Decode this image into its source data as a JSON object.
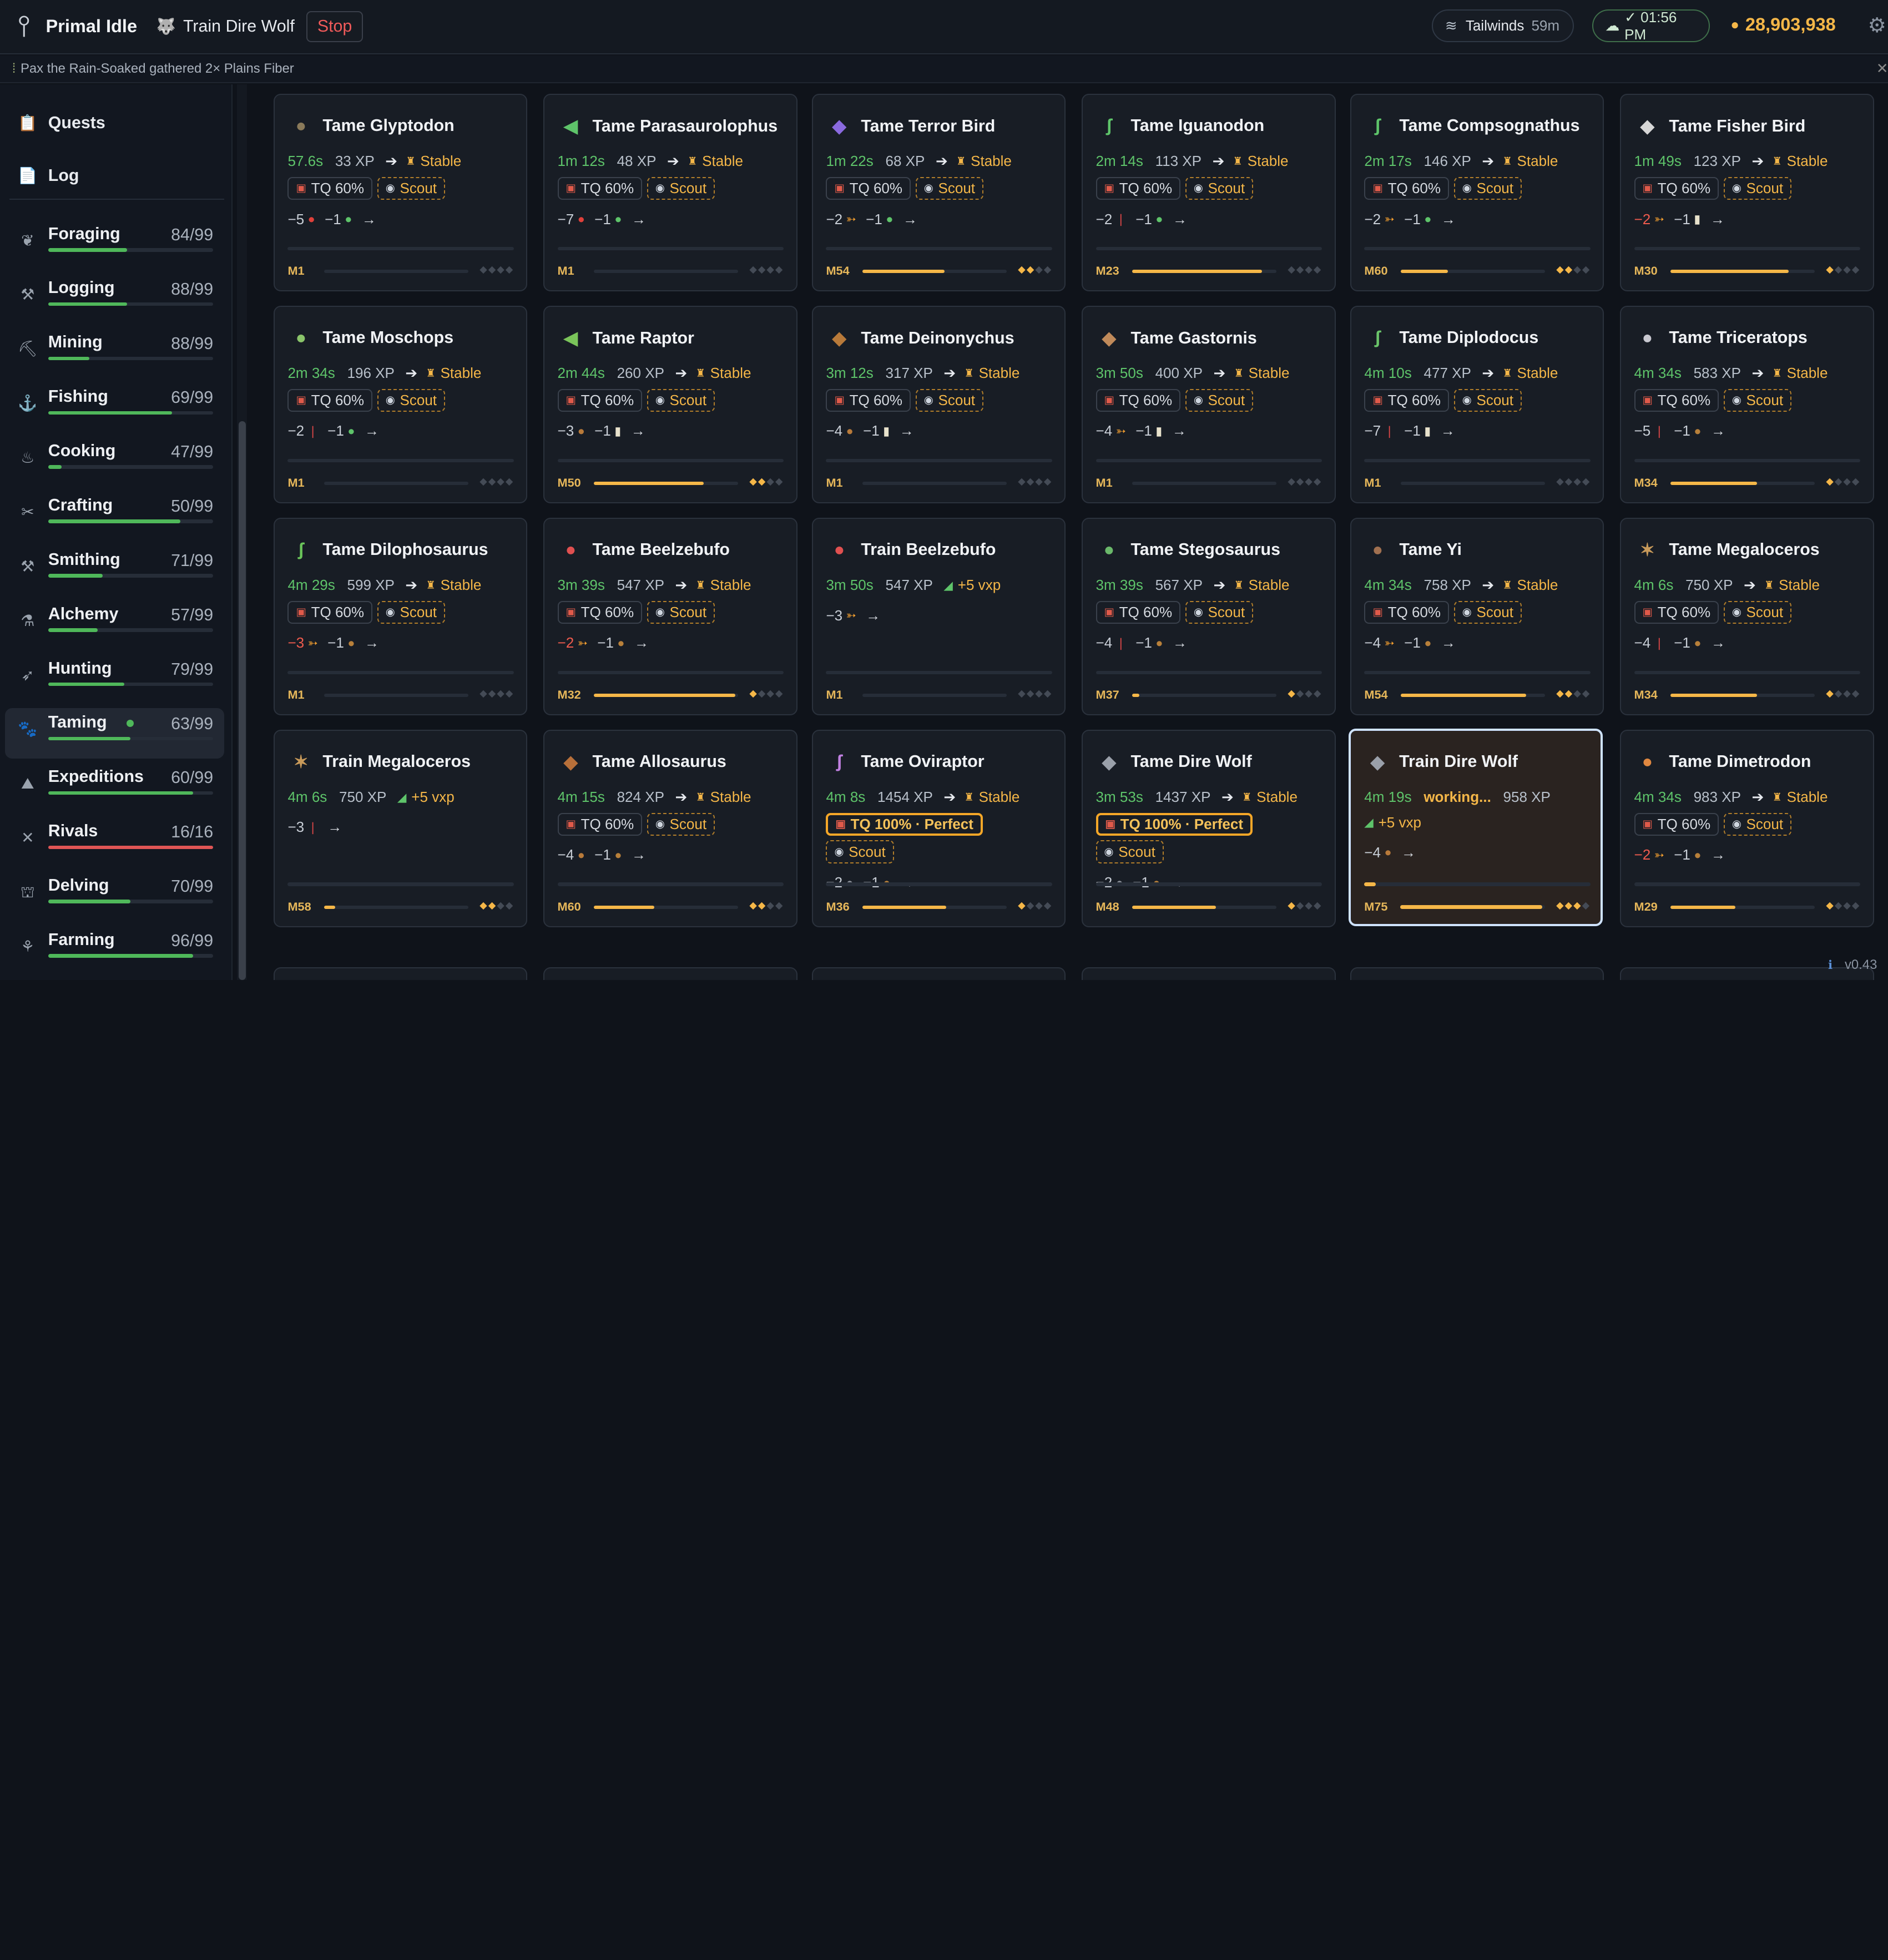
{
  "header": {
    "app_title": "Primal Idle",
    "current_activity": "Train Dire Wolf",
    "current_activity_icon": "wolf-icon",
    "stop_label": "Stop",
    "tailwinds_label": "Tailwinds",
    "tailwinds_time": "59m",
    "clock": "✓ 01:56 PM",
    "gold": "28,903,938"
  },
  "notice": {
    "text": "Pax the Rain-Soaked gathered 2× Plains Fiber"
  },
  "sidebar": {
    "top": [
      {
        "label": "Quests",
        "icon": "quests-icon"
      },
      {
        "label": "Log",
        "icon": "log-icon"
      }
    ],
    "skills": [
      {
        "name": "Foraging",
        "level": "84/99",
        "progress": 0.48,
        "icon": "foraging-icon",
        "color": "#4fb85a"
      },
      {
        "name": "Logging",
        "level": "88/99",
        "progress": 0.48,
        "icon": "logging-icon",
        "color": "#4fb85a"
      },
      {
        "name": "Mining",
        "level": "88/99",
        "progress": 0.25,
        "icon": "mining-icon",
        "color": "#4fb85a"
      },
      {
        "name": "Fishing",
        "level": "69/99",
        "progress": 0.75,
        "icon": "fishing-icon",
        "color": "#4fb85a"
      },
      {
        "name": "Cooking",
        "level": "47/99",
        "progress": 0.08,
        "icon": "cooking-icon",
        "color": "#4fb85a"
      },
      {
        "name": "Crafting",
        "level": "50/99",
        "progress": 0.8,
        "icon": "crafting-icon",
        "color": "#4fb85a"
      },
      {
        "name": "Smithing",
        "level": "71/99",
        "progress": 0.33,
        "icon": "smithing-icon",
        "color": "#4fb85a"
      },
      {
        "name": "Alchemy",
        "level": "57/99",
        "progress": 0.3,
        "icon": "alchemy-icon",
        "color": "#4fb85a"
      },
      {
        "name": "Hunting",
        "level": "79/99",
        "progress": 0.46,
        "icon": "hunting-icon",
        "color": "#4fb85a"
      },
      {
        "name": "Taming",
        "level": "63/99",
        "progress": 0.5,
        "icon": "taming-icon",
        "color": "#4fb85a",
        "active": true
      },
      {
        "name": "Expeditions",
        "level": "60/99",
        "progress": 0.88,
        "icon": "expeditions-icon",
        "color": "#4fb85a"
      },
      {
        "name": "Rivals",
        "level": "16/16",
        "progress": 1.0,
        "icon": "rivals-icon",
        "color": "#e05555"
      },
      {
        "name": "Delving",
        "level": "70/99",
        "progress": 0.5,
        "icon": "delving-icon",
        "color": "#4fb85a"
      },
      {
        "name": "Farming",
        "level": "96/99",
        "progress": 0.88,
        "icon": "farming-icon",
        "color": "#4fb85a"
      }
    ]
  },
  "cards": [
    {
      "title": "Tame Glyptodon",
      "icon": "glyptodon-icon",
      "time": "57.6s",
      "xp": "33 XP",
      "result": "Stable",
      "tags": [
        "TQ 60%",
        "Scout"
      ],
      "reqs": [
        {
          "n": "−5",
          "i": "red-berry-icon"
        },
        {
          "n": "−1",
          "i": "green-drop-icon"
        }
      ],
      "mastery": "M1",
      "mprog": 0.0,
      "diamonds": 0
    },
    {
      "title": "Tame Parasaurolophus",
      "icon": "parasaurolophus-icon",
      "time": "1m 12s",
      "xp": "48 XP",
      "result": "Stable",
      "tags": [
        "TQ 60%",
        "Scout"
      ],
      "reqs": [
        {
          "n": "−7",
          "i": "red-berry-icon"
        },
        {
          "n": "−1",
          "i": "green-drop-icon"
        }
      ],
      "mastery": "M1",
      "mprog": 0.0,
      "diamonds": 0
    },
    {
      "title": "Tame Terror Bird",
      "icon": "terror-bird-icon",
      "time": "1m 22s",
      "xp": "68 XP",
      "result": "Stable",
      "tags": [
        "TQ 60%",
        "Scout"
      ],
      "reqs": [
        {
          "n": "−2",
          "i": "fish-icon"
        },
        {
          "n": "−1",
          "i": "green-drop-icon"
        }
      ],
      "mastery": "M54",
      "mprog": 0.57,
      "diamonds": 2
    },
    {
      "title": "Tame Iguanodon",
      "icon": "iguanodon-icon",
      "time": "2m 14s",
      "xp": "113 XP",
      "result": "Stable",
      "tags": [
        "TQ 60%",
        "Scout"
      ],
      "reqs": [
        {
          "n": "−2",
          "i": "red-stick-icon"
        },
        {
          "n": "−1",
          "i": "green-drop-icon"
        }
      ],
      "mastery": "M23",
      "mprog": 0.9,
      "diamonds": 0
    },
    {
      "title": "Tame Compsognathus",
      "icon": "compsognathus-icon",
      "time": "2m 17s",
      "xp": "146 XP",
      "result": "Stable",
      "tags": [
        "TQ 60%",
        "Scout"
      ],
      "reqs": [
        {
          "n": "−2",
          "i": "fish-icon"
        },
        {
          "n": "−1",
          "i": "green-drop-icon"
        }
      ],
      "mastery": "M60",
      "mprog": 0.33,
      "diamonds": 2
    },
    {
      "title": "Tame Fisher Bird",
      "icon": "fisher-bird-icon",
      "time": "1m 49s",
      "xp": "123 XP",
      "result": "Stable",
      "tags": [
        "TQ 60%",
        "Scout"
      ],
      "reqs": [
        {
          "n": "−2",
          "i": "fish-icon",
          "red": true
        },
        {
          "n": "−1",
          "i": "jar-icon"
        }
      ],
      "mastery": "M30",
      "mprog": 0.82,
      "diamonds": 1
    },
    {
      "title": "Tame Moschops",
      "icon": "moschops-icon",
      "time": "2m 34s",
      "xp": "196 XP",
      "result": "Stable",
      "tags": [
        "TQ 60%",
        "Scout"
      ],
      "reqs": [
        {
          "n": "−2",
          "i": "red-stick-icon"
        },
        {
          "n": "−1",
          "i": "green-drop-icon"
        }
      ],
      "mastery": "M1",
      "mprog": 0.0,
      "diamonds": 0
    },
    {
      "title": "Tame Raptor",
      "icon": "raptor-icon",
      "time": "2m 44s",
      "xp": "260 XP",
      "result": "Stable",
      "tags": [
        "TQ 60%",
        "Scout"
      ],
      "reqs": [
        {
          "n": "−3",
          "i": "meat-icon"
        },
        {
          "n": "−1",
          "i": "jar-icon"
        }
      ],
      "mastery": "M50",
      "mprog": 0.76,
      "diamonds": 2
    },
    {
      "title": "Tame Deinonychus",
      "icon": "deinonychus-icon",
      "time": "3m 12s",
      "xp": "317 XP",
      "result": "Stable",
      "tags": [
        "TQ 60%",
        "Scout"
      ],
      "reqs": [
        {
          "n": "−4",
          "i": "meat-icon"
        },
        {
          "n": "−1",
          "i": "jar-icon"
        }
      ],
      "mastery": "M1",
      "mprog": 0.0,
      "diamonds": 0
    },
    {
      "title": "Tame Gastornis",
      "icon": "gastornis-icon",
      "time": "3m 50s",
      "xp": "400 XP",
      "result": "Stable",
      "tags": [
        "TQ 60%",
        "Scout"
      ],
      "reqs": [
        {
          "n": "−4",
          "i": "fish-icon"
        },
        {
          "n": "−1",
          "i": "jar-icon"
        }
      ],
      "mastery": "M1",
      "mprog": 0.0,
      "diamonds": 0
    },
    {
      "title": "Tame Diplodocus",
      "icon": "diplodocus-icon",
      "time": "4m 10s",
      "xp": "477 XP",
      "result": "Stable",
      "tags": [
        "TQ 60%",
        "Scout"
      ],
      "reqs": [
        {
          "n": "−7",
          "i": "red-stick-icon"
        },
        {
          "n": "−1",
          "i": "jar-icon"
        }
      ],
      "mastery": "M1",
      "mprog": 0.0,
      "diamonds": 0
    },
    {
      "title": "Tame Triceratops",
      "icon": "triceratops-icon",
      "time": "4m 34s",
      "xp": "583 XP",
      "result": "Stable",
      "tags": [
        "TQ 60%",
        "Scout"
      ],
      "reqs": [
        {
          "n": "−5",
          "i": "red-stick-icon"
        },
        {
          "n": "−1",
          "i": "acorn-icon"
        }
      ],
      "mastery": "M34",
      "mprog": 0.6,
      "diamonds": 1
    },
    {
      "title": "Tame Dilophosaurus",
      "icon": "dilophosaurus-icon",
      "time": "4m 29s",
      "xp": "599 XP",
      "result": "Stable",
      "tags": [
        "TQ 60%",
        "Scout"
      ],
      "reqs": [
        {
          "n": "−3",
          "i": "fish-icon",
          "red": true
        },
        {
          "n": "−1",
          "i": "acorn-icon"
        }
      ],
      "mastery": "M1",
      "mprog": 0.0,
      "diamonds": 0
    },
    {
      "title": "Tame Beelzebufo",
      "icon": "beelzebufo-icon",
      "time": "3m 39s",
      "xp": "547 XP",
      "result": "Stable",
      "tags": [
        "TQ 60%",
        "Scout"
      ],
      "reqs": [
        {
          "n": "−2",
          "i": "fish-icon",
          "red": true
        },
        {
          "n": "−1",
          "i": "acorn-icon"
        }
      ],
      "mastery": "M32",
      "mprog": 0.98,
      "diamonds": 1
    },
    {
      "title": "Train Beelzebufo",
      "icon": "beelzebufo-train-icon",
      "time": "3m 50s",
      "xp": "547 XP",
      "vxp": "+5 vxp",
      "tags": [],
      "reqs": [
        {
          "n": "−3",
          "i": "fish-icon"
        }
      ],
      "mastery": "M1",
      "mprog": 0.0,
      "diamonds": 0
    },
    {
      "title": "Tame Stegosaurus",
      "icon": "stegosaurus-icon",
      "time": "3m 39s",
      "xp": "567 XP",
      "result": "Stable",
      "tags": [
        "TQ 60%",
        "Scout"
      ],
      "reqs": [
        {
          "n": "−4",
          "i": "red-stick-icon"
        },
        {
          "n": "−1",
          "i": "acorn-icon"
        }
      ],
      "mastery": "M37",
      "mprog": 0.05,
      "diamonds": 1
    },
    {
      "title": "Tame Yi",
      "icon": "yi-icon",
      "time": "4m 34s",
      "xp": "758 XP",
      "result": "Stable",
      "tags": [
        "TQ 60%",
        "Scout"
      ],
      "reqs": [
        {
          "n": "−4",
          "i": "fish-icon"
        },
        {
          "n": "−1",
          "i": "acorn-icon"
        }
      ],
      "mastery": "M54",
      "mprog": 0.87,
      "diamonds": 2
    },
    {
      "title": "Tame Megaloceros",
      "icon": "megaloceros-icon",
      "time": "4m 6s",
      "xp": "750 XP",
      "result": "Stable",
      "tags": [
        "TQ 60%",
        "Scout"
      ],
      "reqs": [
        {
          "n": "−4",
          "i": "red-stick-icon"
        },
        {
          "n": "−1",
          "i": "acorn-icon"
        }
      ],
      "mastery": "M34",
      "mprog": 0.6,
      "diamonds": 1
    },
    {
      "title": "Train Megaloceros",
      "icon": "megaloceros-train-icon",
      "time": "4m 6s",
      "xp": "750 XP",
      "vxp": "+5 vxp",
      "tags": [],
      "reqs": [
        {
          "n": "−3",
          "i": "red-stick-icon"
        }
      ],
      "mastery": "M58",
      "mprog": 0.08,
      "diamonds": 2
    },
    {
      "title": "Tame Allosaurus",
      "icon": "allosaurus-icon",
      "time": "4m 15s",
      "xp": "824 XP",
      "result": "Stable",
      "tags": [
        "TQ 60%",
        "Scout"
      ],
      "reqs": [
        {
          "n": "−4",
          "i": "meat-icon"
        },
        {
          "n": "−1",
          "i": "acorn-icon"
        }
      ],
      "mastery": "M60",
      "mprog": 0.42,
      "diamonds": 2
    },
    {
      "title": "Tame Oviraptor",
      "icon": "oviraptor-icon",
      "time": "4m 8s",
      "xp": "1454 XP",
      "result": "Stable",
      "tags": [
        "TQ 100% · Perfect",
        "Scout"
      ],
      "reqs": [
        {
          "n": "−2",
          "i": "stone-icon"
        },
        {
          "n": "−1",
          "i": "acorn-icon"
        }
      ],
      "mastery": "M36",
      "mprog": 0.58,
      "diamonds": 1
    },
    {
      "title": "Tame Dire Wolf",
      "icon": "dire-wolf-icon",
      "time": "3m 53s",
      "xp": "1437 XP",
      "result": "Stable",
      "tags": [
        "TQ 100% · Perfect",
        "Scout"
      ],
      "reqs": [
        {
          "n": "−2",
          "i": "stone-icon"
        },
        {
          "n": "−1",
          "i": "acorn-icon"
        }
      ],
      "mastery": "M48",
      "mprog": 0.58,
      "diamonds": 1
    },
    {
      "title": "Train Dire Wolf",
      "icon": "dire-wolf-train-icon",
      "time": "4m 19s",
      "working": "working...",
      "xp": "958 XP",
      "vxp": "+5 vxp",
      "tags": [],
      "reqs": [
        {
          "n": "−4",
          "i": "meat-icon"
        }
      ],
      "mastery": "M75",
      "mprog": 0.98,
      "diamonds": 3,
      "active": true,
      "taskprog": 0.05
    },
    {
      "title": "Tame Dimetrodon",
      "icon": "dimetrodon-icon",
      "time": "4m 34s",
      "xp": "983 XP",
      "result": "Stable",
      "tags": [
        "TQ 60%",
        "Scout"
      ],
      "reqs": [
        {
          "n": "−2",
          "i": "fish-icon",
          "red": true
        },
        {
          "n": "−1",
          "i": "acorn-icon"
        }
      ],
      "mastery": "M29",
      "mprog": 0.45,
      "diamonds": 1
    }
  ],
  "footer": {
    "version": "v0.43"
  }
}
